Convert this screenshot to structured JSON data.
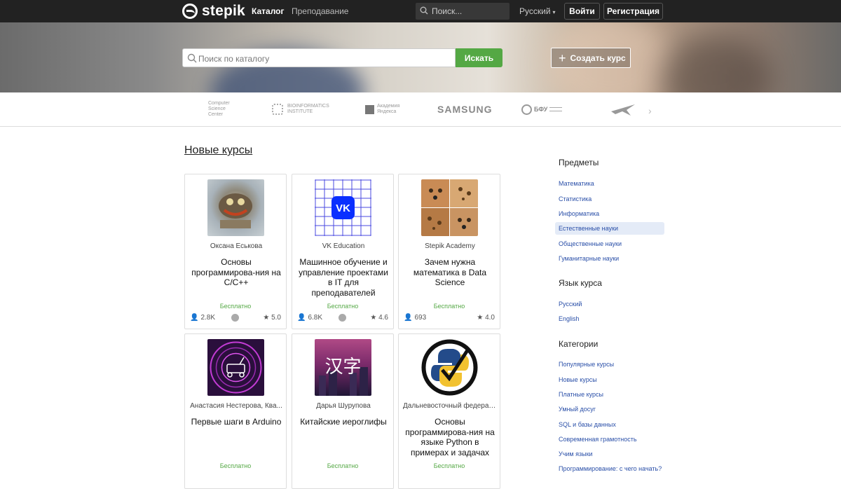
{
  "header": {
    "logo": "stepik",
    "nav": [
      "Каталог",
      "Преподавание"
    ],
    "search_placeholder": "Поиск...",
    "language": "Русский",
    "login": "Войти",
    "register": "Регистрация"
  },
  "hero": {
    "search_placeholder": "Поиск по каталогу",
    "search_button": "Искать",
    "create_course": "Создать курс"
  },
  "partners": {
    "csc": "Computer\nScience\nCenter",
    "bioinf": "BIOINFORMATICS\nINSTITUTE",
    "yandex": "Академия\nЯндекса",
    "samsung": "SAMSUNG",
    "bfu": "БФУ"
  },
  "section_title": "Новые курсы",
  "courses": [
    {
      "author": "Оксана Еськова",
      "title": "Основы программирова-ния на C/C++",
      "price": "Бесплатно",
      "learners": "2.8K",
      "rating": "5.0"
    },
    {
      "author": "VK Education",
      "title": "Машинное обучение и управление проектами в IT для преподавателей",
      "price": "Бесплатно",
      "learners": "6.8K",
      "rating": "4.6"
    },
    {
      "author": "Stepik Academy",
      "title": "Зачем нужна математика в Data Science",
      "price": "Бесплатно",
      "learners": "693",
      "rating": "4.0"
    },
    {
      "author": "Анастасия Нестерова,  Ква...",
      "title": "Первые шаги в Arduino",
      "price": "Бесплатно"
    },
    {
      "author": "Дарья Шурупова",
      "title": "Китайские иероглифы",
      "price": "Бесплатно",
      "image_text": "汉字"
    },
    {
      "author": "Дальневосточный федерал...",
      "title": "Основы программирова-ния на языке Python в примерах и задачах",
      "price": "Бесплатно"
    }
  ],
  "sidebar": {
    "subjects_title": "Предметы",
    "subjects": [
      "Математика",
      "Статистика",
      "Информатика",
      "Естественные науки",
      "Общественные науки",
      "Гуманитарные науки"
    ],
    "lang_title": "Язык курса",
    "langs": [
      "Русский",
      "English"
    ],
    "cat_title": "Категории",
    "categories": [
      "Популярные курсы",
      "Новые курсы",
      "Платные курсы",
      "Умный досуг",
      "SQL и базы данных",
      "Современная грамотность",
      "Учим языки",
      "Программирование: с чего начать?"
    ]
  },
  "colors": {
    "accent_green": "#54a844",
    "link_blue": "#2a4fa8",
    "topbar": "#222222"
  }
}
